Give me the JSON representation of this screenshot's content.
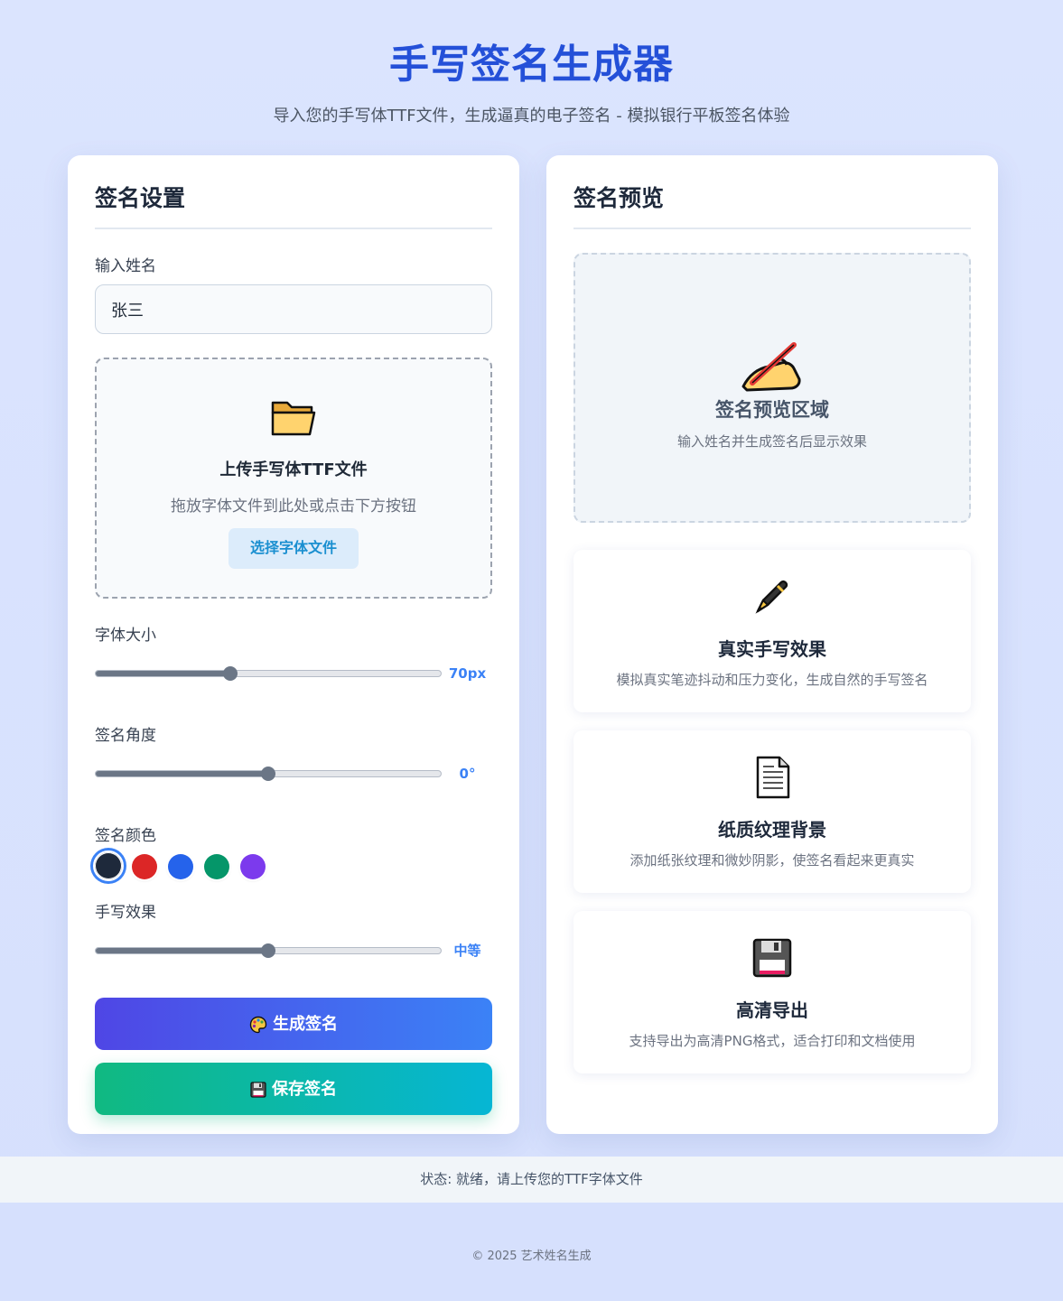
{
  "header": {
    "title": "手写签名生成器",
    "subtitle": "导入您的手写体TTF文件，生成逼真的电子签名 - 模拟银行平板签名体验"
  },
  "settings": {
    "title": "签名设置",
    "name_label": "输入姓名",
    "name_value": "张三",
    "upload": {
      "icon": "folder-icon",
      "title": "上传手写体TTF文件",
      "hint": "拖放字体文件到此处或点击下方按钮",
      "button": "选择字体文件"
    },
    "font_size": {
      "label": "字体大小",
      "value_text": "70px",
      "level": 0.39
    },
    "angle": {
      "label": "签名角度",
      "value_text": "0°",
      "level": 0.5
    },
    "color": {
      "label": "签名颜色",
      "swatches": [
        "#1e293b",
        "#dc2626",
        "#2563eb",
        "#059669",
        "#7c3aed"
      ],
      "selected": 0
    },
    "effect": {
      "label": "手写效果",
      "value_text": "中等",
      "level": 0.5
    },
    "generate_button": "生成签名",
    "save_button": "保存签名"
  },
  "preview": {
    "title": "签名预览",
    "area_title": "签名预览区域",
    "area_hint": "输入姓名并生成签名后显示效果",
    "features": [
      {
        "icon": "fountain-pen-icon",
        "title": "真实手写效果",
        "desc": "模拟真实笔迹抖动和压力变化，生成自然的手写签名"
      },
      {
        "icon": "paper-icon",
        "title": "纸质纹理背景",
        "desc": "添加纸张纹理和微妙阴影，使签名看起来更真实"
      },
      {
        "icon": "floppy-disk-icon",
        "title": "高清导出",
        "desc": "支持导出为高清PNG格式，适合打印和文档使用"
      }
    ]
  },
  "status": "状态: 就绪，请上传您的TTF字体文件",
  "footer": "© 2025 艺术姓名生成"
}
